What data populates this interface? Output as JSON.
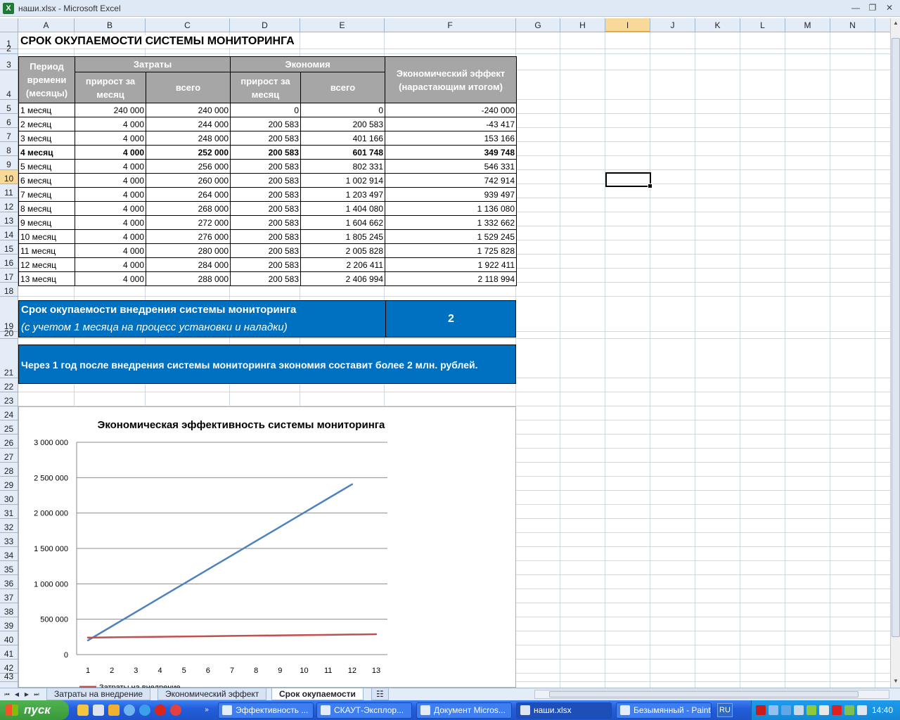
{
  "window": {
    "title": "наши.xlsx - Microsoft Excel",
    "app_icon": "X"
  },
  "columns": [
    "A",
    "B",
    "C",
    "D",
    "E",
    "F",
    "G",
    "H",
    "I",
    "J",
    "K",
    "L",
    "M",
    "N"
  ],
  "rows": [
    "1",
    "2",
    "3",
    "4",
    "5",
    "6",
    "7",
    "8",
    "9",
    "10",
    "11",
    "12",
    "13",
    "14",
    "15",
    "16",
    "17",
    "18",
    "19",
    "20",
    "21",
    "22",
    "23",
    "24",
    "25",
    "26",
    "27",
    "28",
    "29",
    "30",
    "31",
    "32",
    "33",
    "34",
    "35",
    "36",
    "37",
    "38",
    "39",
    "40",
    "41",
    "42",
    "43"
  ],
  "selected_column": "I",
  "selected_row": "10",
  "sheet": {
    "title": "СРОК ОКУПАЕМОСТИ СИСТЕМЫ МОНИТОРИНГА",
    "headers": {
      "period": "Период времени (месяцы)",
      "costs": "Затраты",
      "savings": "Экономия",
      "effect": "Экономический эффект (нарастающим итогом)",
      "increment": "прирост за месяц",
      "total": "всего",
      "increment2": "прирост за месяц",
      "total2": "всего"
    },
    "rows": [
      [
        "1 месяц",
        "240 000",
        "240 000",
        "0",
        "0",
        "-240 000"
      ],
      [
        "2 месяц",
        "4 000",
        "244 000",
        "200 583",
        "200 583",
        "-43 417"
      ],
      [
        "3 месяц",
        "4 000",
        "248 000",
        "200 583",
        "401 166",
        "153 166"
      ],
      [
        "4 месяц",
        "4 000",
        "252 000",
        "200 583",
        "601 748",
        "349 748"
      ],
      [
        "5 месяц",
        "4 000",
        "256 000",
        "200 583",
        "802 331",
        "546 331"
      ],
      [
        "6 месяц",
        "4 000",
        "260 000",
        "200 583",
        "1 002 914",
        "742 914"
      ],
      [
        "7 месяц",
        "4 000",
        "264 000",
        "200 583",
        "1 203 497",
        "939 497"
      ],
      [
        "8 месяц",
        "4 000",
        "268 000",
        "200 583",
        "1 404 080",
        "1 136 080"
      ],
      [
        "9 месяц",
        "4 000",
        "272 000",
        "200 583",
        "1 604 662",
        "1 332 662"
      ],
      [
        "10 месяц",
        "4 000",
        "276 000",
        "200 583",
        "1 805 245",
        "1 529 245"
      ],
      [
        "11 месяц",
        "4 000",
        "280 000",
        "200 583",
        "2 005 828",
        "1 725 828"
      ],
      [
        "12 месяц",
        "4 000",
        "284 000",
        "200 583",
        "2 206 411",
        "1 922 411"
      ],
      [
        "13 месяц",
        "4 000",
        "288 000",
        "200 583",
        "2 406 994",
        "2 118 994"
      ]
    ],
    "payback_label_line1": "Срок окупаемости внедрения системы мониторинга",
    "payback_label_line2": "(с учетом 1 месяца  на процесс установки и наладки)",
    "payback_value": "2",
    "conclusion": "Через 1 год после внедрения системы мониторинга экономия составит  более 2 млн. рублей."
  },
  "chart_data": {
    "type": "line",
    "title": "Экономическая эффективность системы мониторинга",
    "x": [
      1,
      2,
      3,
      4,
      5,
      6,
      7,
      8,
      9,
      10,
      11,
      12,
      13
    ],
    "ylim": [
      0,
      3000000
    ],
    "yticks": [
      "0",
      "500 000",
      "1 000 000",
      "1 500 000",
      "2 000 000",
      "2 500 000",
      "3 000 000"
    ],
    "ytick_values": [
      0,
      500000,
      1000000,
      1500000,
      2000000,
      2500000,
      3000000
    ],
    "grid": true,
    "legend": "bottom",
    "series": [
      {
        "color": "#4f81bd",
        "values": [
          200583,
          401166,
          601748,
          802331,
          1002914,
          1203497,
          1404080,
          1604662,
          1805245,
          2005828,
          2206411,
          2406994
        ]
      },
      {
        "name": "Затраты на внедрение",
        "color": "#c0504d",
        "values": [
          240000,
          244000,
          248000,
          252000,
          256000,
          260000,
          264000,
          268000,
          272000,
          276000,
          280000,
          284000,
          288000
        ]
      }
    ]
  },
  "tabs": [
    "Затраты на внедрение",
    "Экономический эффект",
    "Срок окупаемости"
  ],
  "active_tab": 2,
  "taskbar": {
    "start": "пуск",
    "tasks": [
      "Эффективность ...",
      "СКАУТ-Эксплор...",
      "Документ Micros...",
      "наши.xlsx",
      "Безымянный - Paint"
    ],
    "active_task": 3,
    "lang": "RU",
    "clock": "14:40"
  },
  "colors": {
    "blue_box": "#0070c0",
    "header_gray": "#a6a6a6",
    "taskbar": "#245edb",
    "start": "#3a9a3a"
  }
}
